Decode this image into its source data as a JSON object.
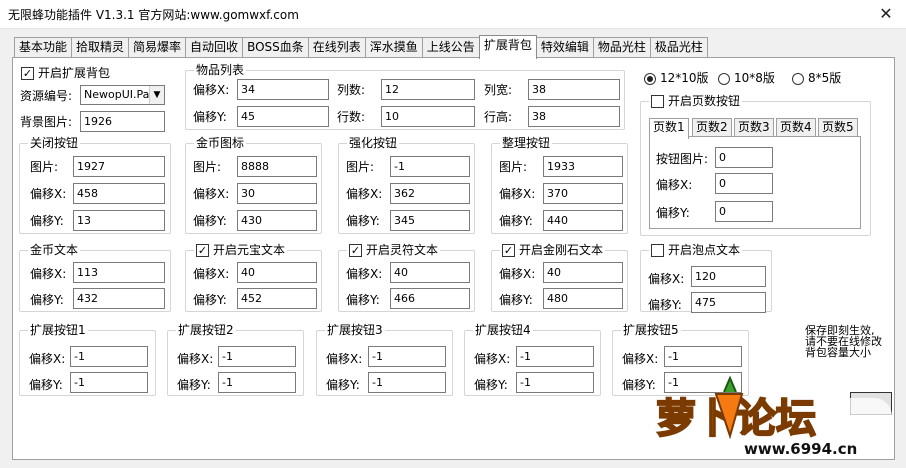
{
  "window": {
    "title": "无限蜂功能插件 V1.3.1  官方网站:www.gomwxf.com",
    "close": "✕"
  },
  "tabs": [
    "基本功能",
    "拾取精灵",
    "简易爆率",
    "自动回收",
    "BOSS血条",
    "在线列表",
    "浑水摸鱼",
    "上线公告",
    "扩展背包",
    "特效编辑",
    "物品光柱",
    "极品光柱"
  ],
  "main": {
    "enable_label": "开启扩展背包",
    "enable_checked": "✓",
    "resource_label": "资源编号:",
    "resource_value": "NewopUI.Pak",
    "bgimg_label": "背景图片:",
    "bgimg_value": "1926"
  },
  "itemlist": {
    "title": "物品列表",
    "offx_label": "偏移X:",
    "offx": "34",
    "offy_label": "偏移Y:",
    "offy": "45",
    "cols_label": "列数:",
    "cols": "12",
    "rows_label": "行数:",
    "rows": "10",
    "colw_label": "列宽:",
    "colw": "38",
    "rowh_label": "行高:",
    "rowh": "38"
  },
  "versions": {
    "v1": "12*10版",
    "v2": "10*8版",
    "v3": "8*5版"
  },
  "pages": {
    "enable_label": "开启页数按钮",
    "tabs": [
      "页数1",
      "页数2",
      "页数3",
      "页数4",
      "页数5"
    ],
    "btnimg_label": "按钮图片:",
    "btnimg": "0",
    "offx_label": "偏移X:",
    "offx": "0",
    "offy_label": "偏移Y:",
    "offy": "0"
  },
  "groups": {
    "close": {
      "title": "关闭按钮",
      "img_label": "图片:",
      "img": "1927",
      "x_label": "偏移X:",
      "x": "458",
      "y_label": "偏移Y:",
      "y": "13"
    },
    "gold": {
      "title": "金币图标",
      "img_label": "图片:",
      "img": "8888",
      "x_label": "偏移X:",
      "x": "30",
      "y_label": "偏移Y:",
      "y": "430"
    },
    "enhance": {
      "title": "强化按钮",
      "img_label": "图片:",
      "img": "-1",
      "x_label": "偏移X:",
      "x": "362",
      "y_label": "偏移Y:",
      "y": "345"
    },
    "sort": {
      "title": "整理按钮",
      "img_label": "图片:",
      "img": "1933",
      "x_label": "偏移X:",
      "x": "370",
      "y_label": "偏移Y:",
      "y": "440"
    }
  },
  "texts": {
    "goldtext": {
      "title": "金币文本",
      "x_label": "偏移X:",
      "x": "113",
      "y_label": "偏移Y:",
      "y": "432"
    },
    "yuanbao": {
      "title": "开启元宝文本",
      "x_label": "偏移X:",
      "x": "40",
      "y_label": "偏移Y:",
      "y": "452"
    },
    "lingfu": {
      "title": "开启灵符文本",
      "x_label": "偏移X:",
      "x": "40",
      "y_label": "偏移Y:",
      "y": "466"
    },
    "jingang": {
      "title": "开启金刚石文本",
      "x_label": "偏移X:",
      "x": "40",
      "y_label": "偏移Y:",
      "y": "480"
    },
    "paopao": {
      "title": "开启泡点文本",
      "x_label": "偏移X:",
      "x": "120",
      "y_label": "偏移Y:",
      "y": "475"
    }
  },
  "ext": [
    {
      "title": "扩展按钮1",
      "x_label": "偏移X:",
      "x": "-1",
      "y_label": "偏移Y:",
      "y": "-1"
    },
    {
      "title": "扩展按钮2",
      "x_label": "偏移X:",
      "x": "-1",
      "y_label": "偏移Y:",
      "y": "-1"
    },
    {
      "title": "扩展按钮3",
      "x_label": "偏移X:",
      "x": "-1",
      "y_label": "偏移Y:",
      "y": "-1"
    },
    {
      "title": "扩展按钮4",
      "x_label": "偏移X:",
      "x": "-1",
      "y_label": "偏移Y:",
      "y": "-1"
    },
    {
      "title": "扩展按钮5",
      "x_label": "偏移X:",
      "x": "-1",
      "y_label": "偏移Y:",
      "y": "-1"
    }
  ],
  "note": {
    "l1": "保存即刻生效,",
    "l2": "请不要在线修改",
    "l3": "背包容量大小"
  },
  "watermark": {
    "name": "萝卜论坛",
    "url": "www.6994.cn"
  }
}
